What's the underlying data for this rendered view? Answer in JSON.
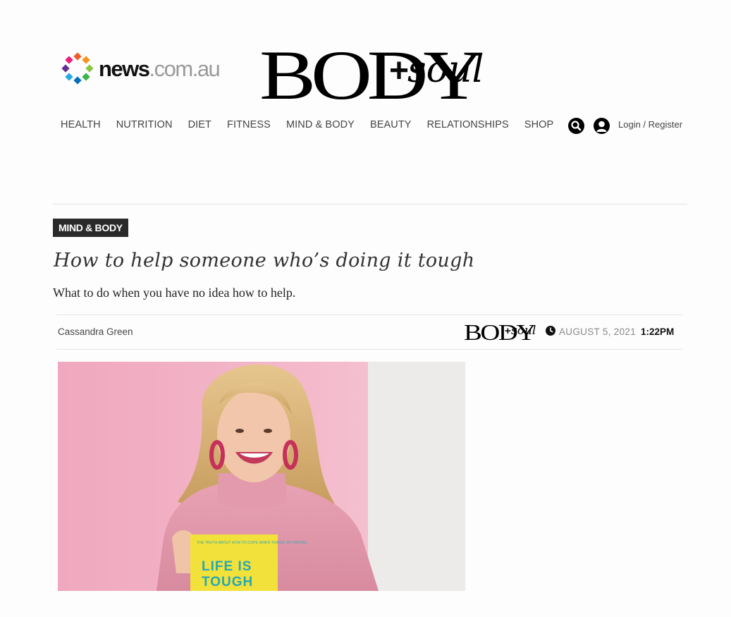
{
  "brand": {
    "network_logo": {
      "bold": "news",
      "light": ".com.au"
    },
    "masthead": {
      "main": "BODY",
      "plus": "+",
      "script": "soul"
    }
  },
  "nav": {
    "items": [
      {
        "label": "HEALTH"
      },
      {
        "label": "NUTRITION"
      },
      {
        "label": "DIET"
      },
      {
        "label": "FITNESS"
      },
      {
        "label": "MIND & BODY"
      },
      {
        "label": "BEAUTY"
      },
      {
        "label": "RELATIONSHIPS"
      },
      {
        "label": "SHOP"
      }
    ],
    "search_icon": "search-icon",
    "user_icon": "user-icon",
    "login_label": "Login",
    "separator": " / ",
    "register_label": "Register"
  },
  "article": {
    "category": "MIND & BODY",
    "headline": "How to help someone who’s doing it tough",
    "standfirst": "What to do when you have no idea how to help.",
    "author": "Cassandra Green",
    "date": "AUGUST 5, 2021",
    "time": "1:22PM",
    "hero_image": {
      "book_subtitle": "THE TRUTH ABOUT HOW TO COPE WHEN THINGS GO WRONG",
      "book_title_line1": "LIFE IS",
      "book_title_line2": "TOUGH"
    }
  },
  "colors": {
    "tag_bg": "#2a2a2a",
    "text": "#333333",
    "pink_wall": "#f0a9bf",
    "book_yellow": "#f3e23a",
    "book_teal": "#27a7b5"
  }
}
